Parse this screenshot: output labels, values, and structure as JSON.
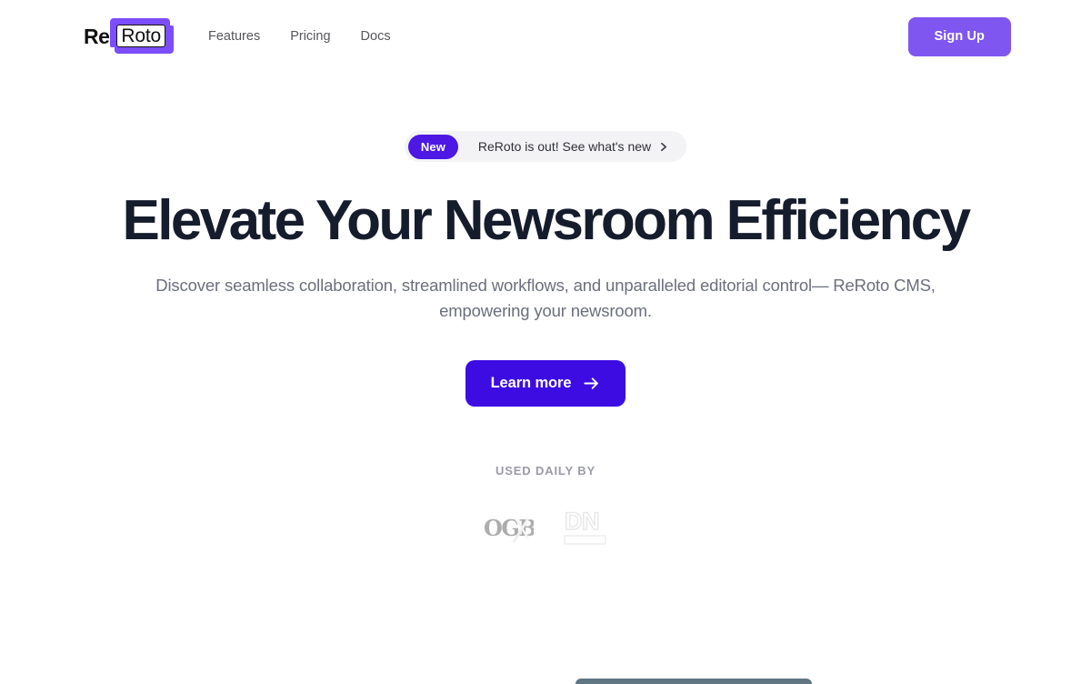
{
  "nav": {
    "logo": {
      "prefix": "Re",
      "mark": "Roto",
      "accent_color": "#7c4dfb"
    },
    "links": [
      {
        "label": "Features"
      },
      {
        "label": "Pricing"
      },
      {
        "label": "Docs"
      }
    ],
    "signup_label": "Sign Up",
    "signup_color": "#7f56f0"
  },
  "hero": {
    "badge": {
      "pill_label": "New",
      "text": "ReRoto is out! See what's new",
      "chevron_icon": "chevron-right-icon",
      "pill_color": "#4d18e4",
      "background": "#f3f3f5"
    },
    "headline": "Elevate Your Newsroom Efficiency",
    "subtitle": "Discover seamless collaboration, streamlined workflows, and unparalleled editorial control— ReRoto CMS, empowering your newsroom.",
    "cta": {
      "label": "Learn more",
      "icon": "arrow-right-icon",
      "color": "#3d0ce2"
    }
  },
  "social_proof": {
    "label": "USED DAILY BY",
    "logos": [
      {
        "name": "ogb-monogram-logo",
        "text": "OGB"
      },
      {
        "name": "dn-logo",
        "text": "DN"
      }
    ]
  }
}
